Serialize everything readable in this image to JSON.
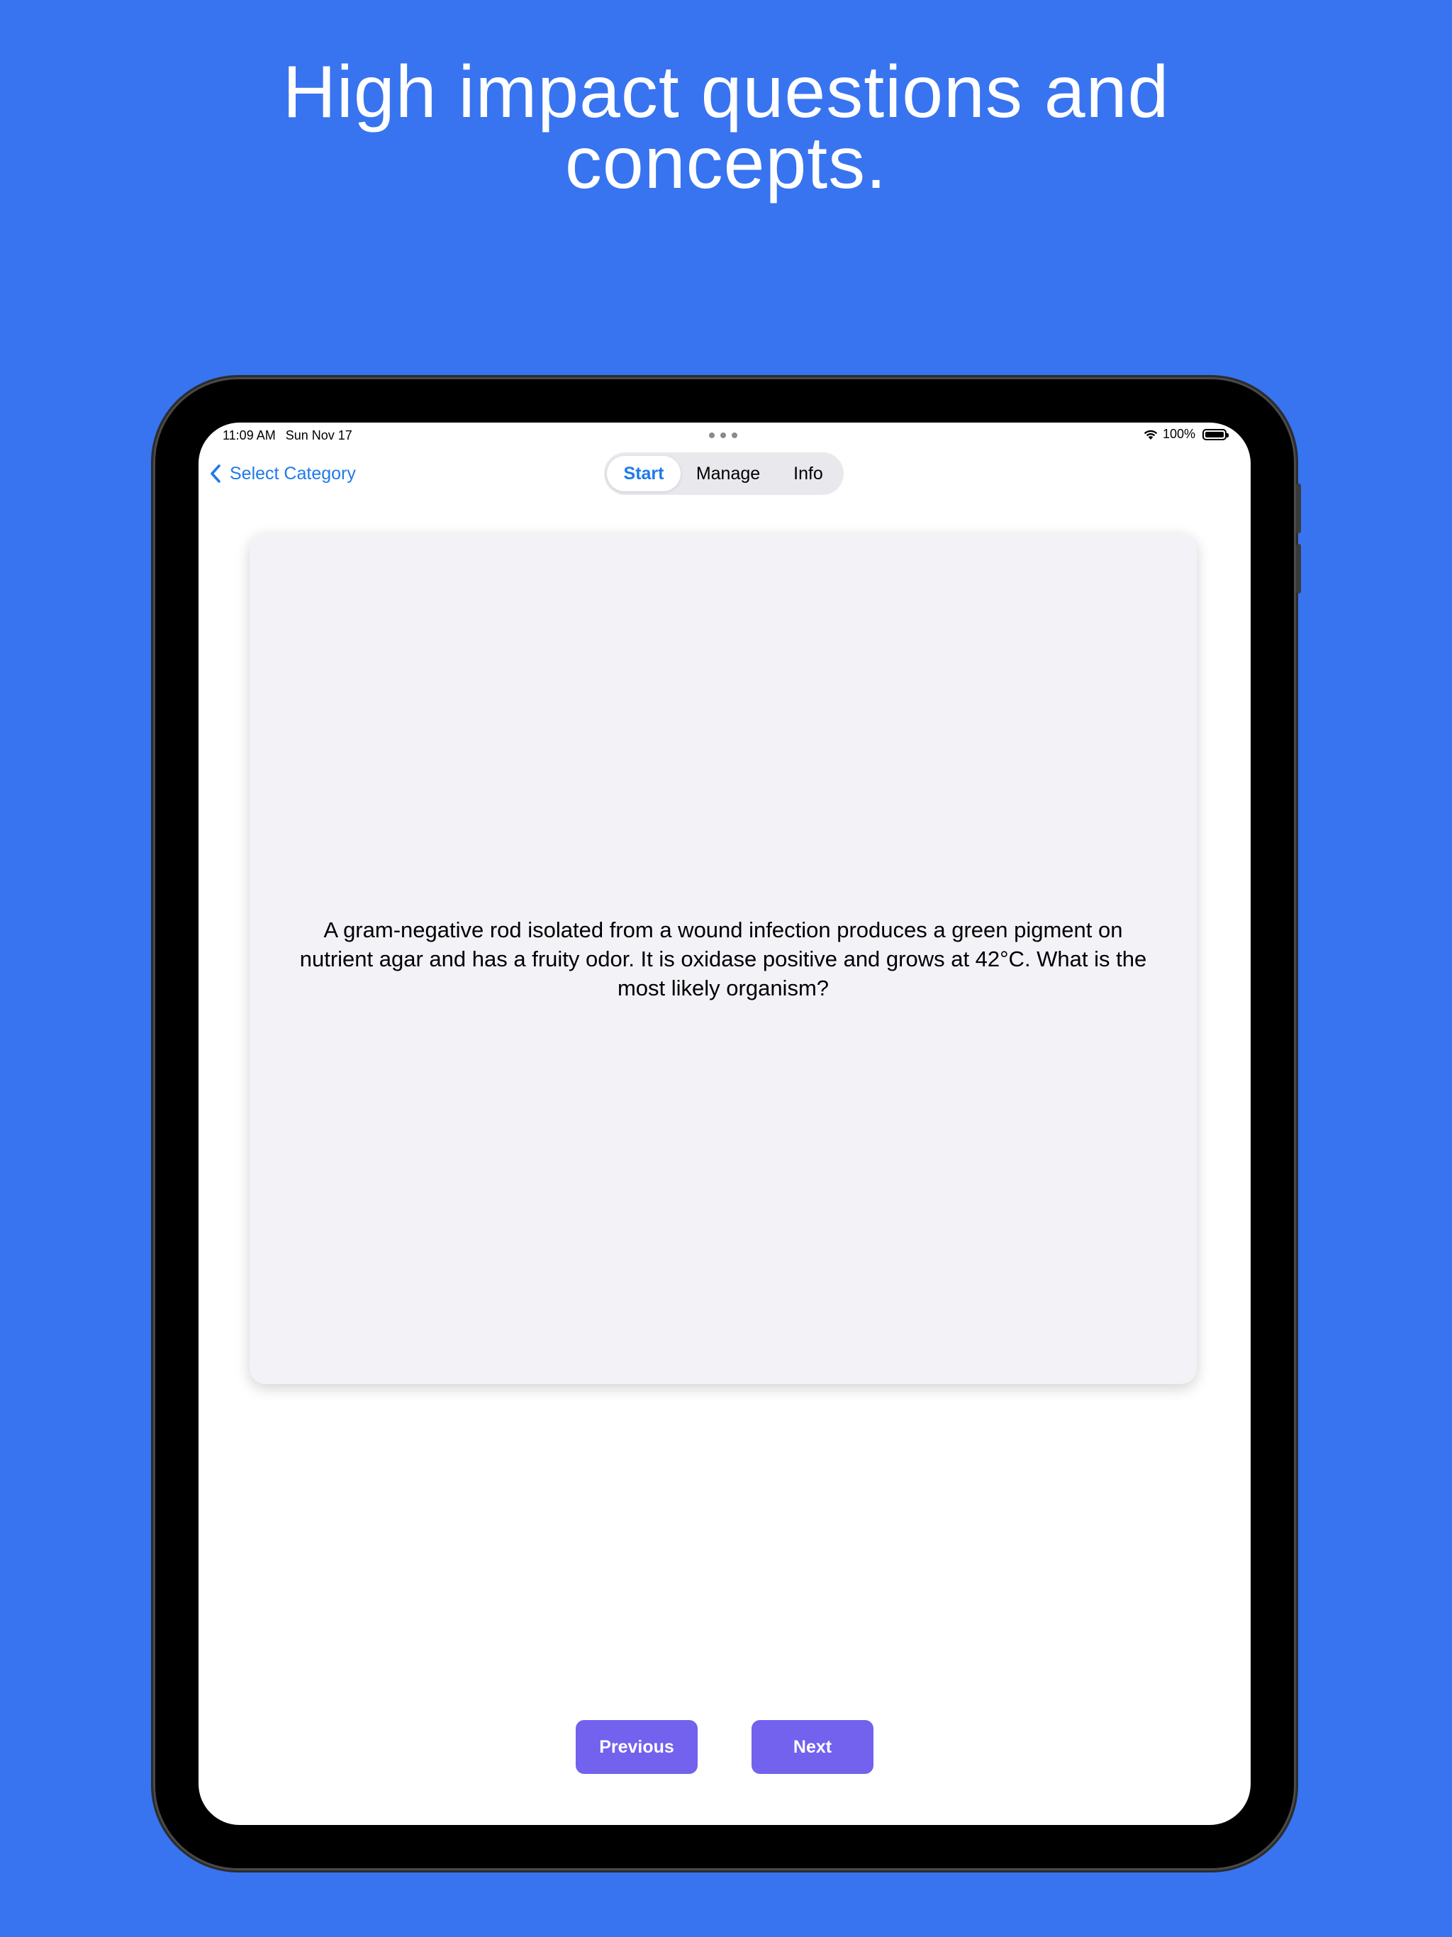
{
  "marketing": {
    "headline_line1": "High impact questions and",
    "headline_line2": "concepts."
  },
  "statusbar": {
    "time": "11:09 AM",
    "date": "Sun Nov 17",
    "battery": "100%"
  },
  "nav": {
    "back_label": "Select Category"
  },
  "tabs": [
    {
      "label": "Start",
      "selected": true
    },
    {
      "label": "Manage",
      "selected": false
    },
    {
      "label": "Info",
      "selected": false
    }
  ],
  "card": {
    "question": "A gram-negative rod isolated from a wound infection produces a green pigment on nutrient agar and has a fruity odor. It is oxidase positive and grows at 42°C. What is the most likely organism?"
  },
  "controls": {
    "previous_label": "Previous",
    "next_label": "Next"
  },
  "colors": {
    "background": "#3874F0",
    "accent": "#1F7AE8",
    "button": "#7262EE",
    "card": "#F2F2F7"
  },
  "icons": {
    "back": "chevron-left-icon",
    "wifi": "wifi-icon",
    "battery": "battery-icon",
    "multitasking": "ellipsis-icon"
  }
}
